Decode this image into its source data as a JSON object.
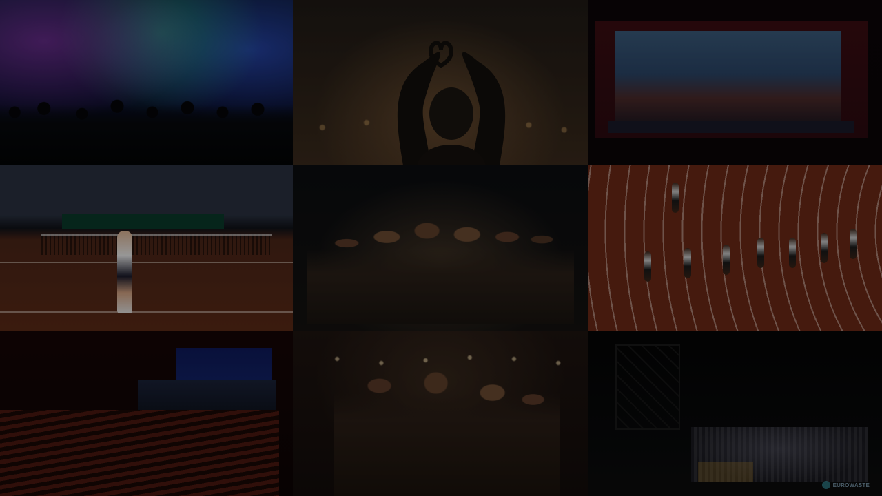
{
  "tiles": [
    {
      "name": "concert-crowd",
      "caption": ""
    },
    {
      "name": "heart-hands",
      "caption": ""
    },
    {
      "name": "theatre-stage",
      "caption": ""
    },
    {
      "name": "tennis-match",
      "caption": ""
    },
    {
      "name": "group-selfie",
      "caption": ""
    },
    {
      "name": "athletics-track",
      "caption": ""
    },
    {
      "name": "auditorium",
      "caption": ""
    },
    {
      "name": "sparkler-party",
      "caption": ""
    },
    {
      "name": "outdoor-event",
      "caption": ""
    }
  ],
  "watermark": {
    "text": "EUROWASTE"
  },
  "colors": {
    "overlay": "#000000",
    "track": "#6a2816",
    "tennis_clay": "#5a2a16"
  }
}
